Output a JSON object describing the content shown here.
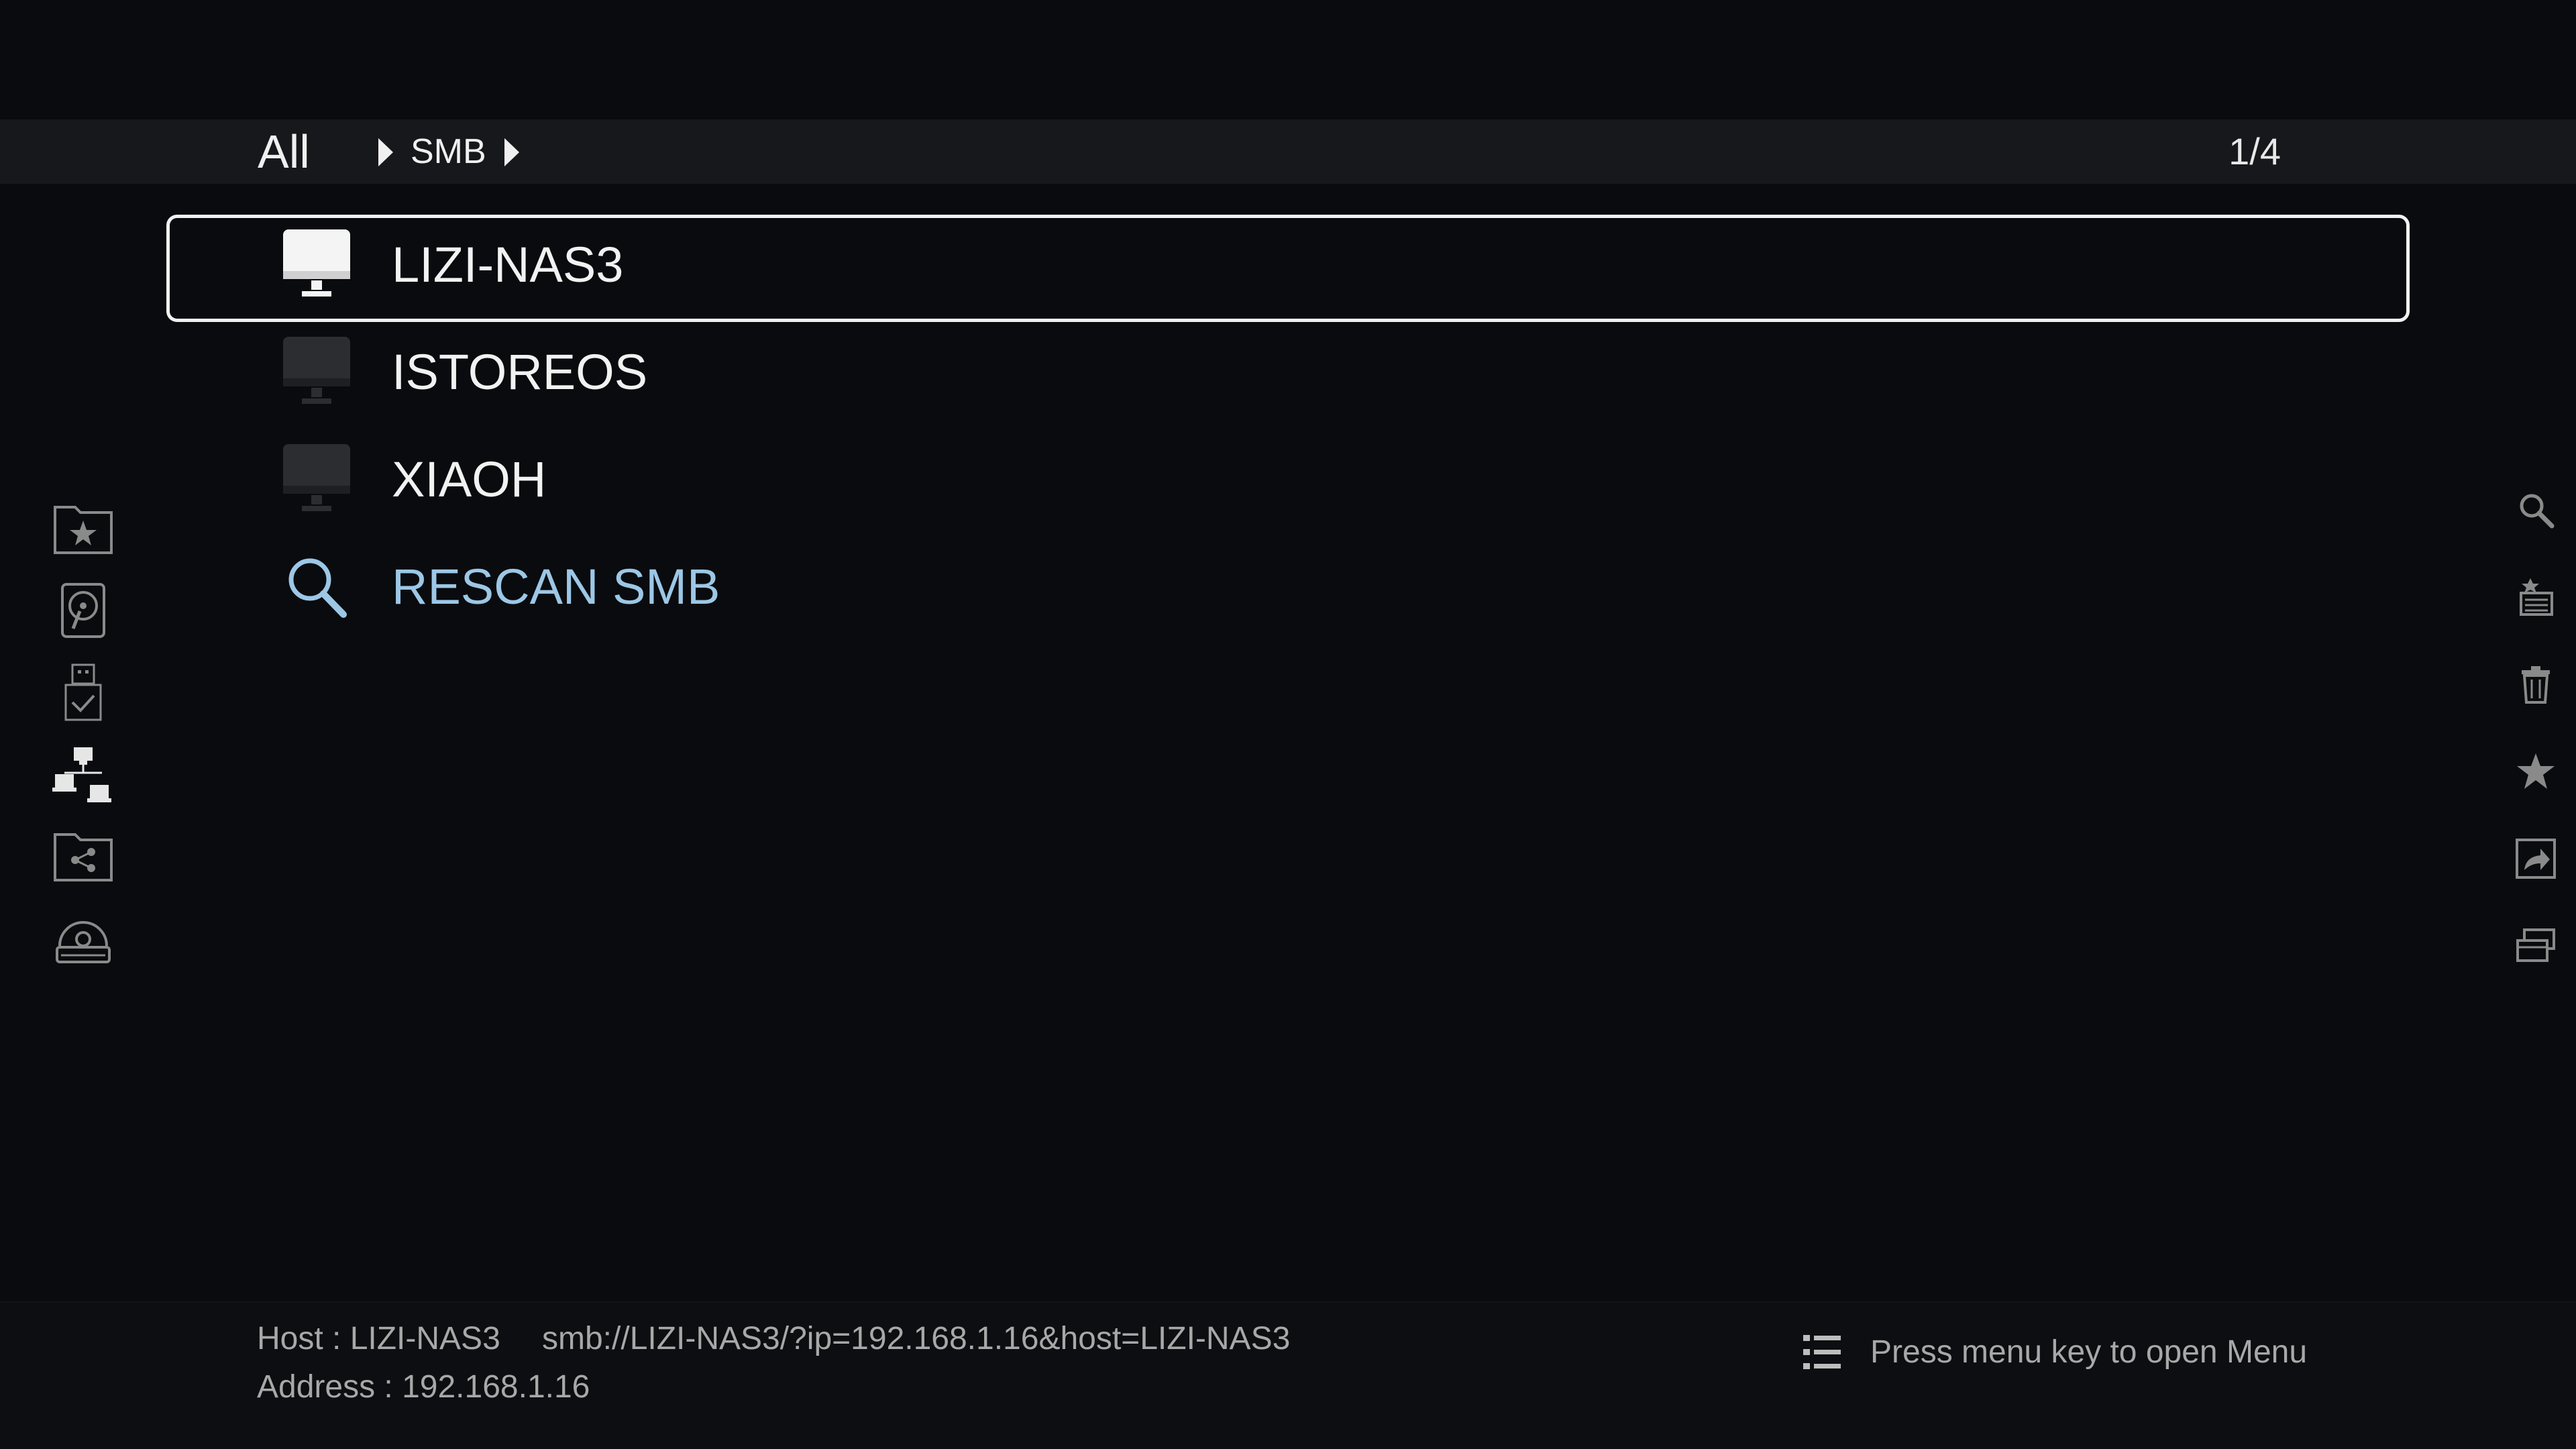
{
  "breadcrumb": {
    "root": "All",
    "current": "SMB"
  },
  "pagination": {
    "text": "1/4"
  },
  "list": {
    "items": [
      {
        "label": "LIZI-NAS3",
        "icon": "computer-icon",
        "selected": true
      },
      {
        "label": "ISTOREOS",
        "icon": "computer-icon",
        "selected": false
      },
      {
        "label": "XIAOH",
        "icon": "computer-icon",
        "selected": false
      },
      {
        "label": "RESCAN SMB",
        "icon": "search-icon",
        "selected": false
      }
    ]
  },
  "left_rail": {
    "icons": [
      "favorite-folder-icon",
      "local-disk-icon",
      "usb-drive-icon",
      "network-icon",
      "shared-folder-icon",
      "optical-drive-icon"
    ]
  },
  "right_rail": {
    "icons": [
      "search-icon",
      "media-library-icon",
      "delete-icon",
      "favorite-icon",
      "share-icon",
      "multi-window-icon"
    ]
  },
  "footer": {
    "host": "Host : LIZI-NAS3",
    "url": "smb://LIZI-NAS3/?ip=192.168.1.16&host=LIZI-NAS3",
    "address": "Address : 192.168.1.16",
    "menu_hint": "Press menu key to open Menu"
  },
  "colors": {
    "background": "#0a0b0e",
    "topbar": "#17181b",
    "action_text": "#9cc7e6",
    "selected_border": "#f2f2f2"
  }
}
